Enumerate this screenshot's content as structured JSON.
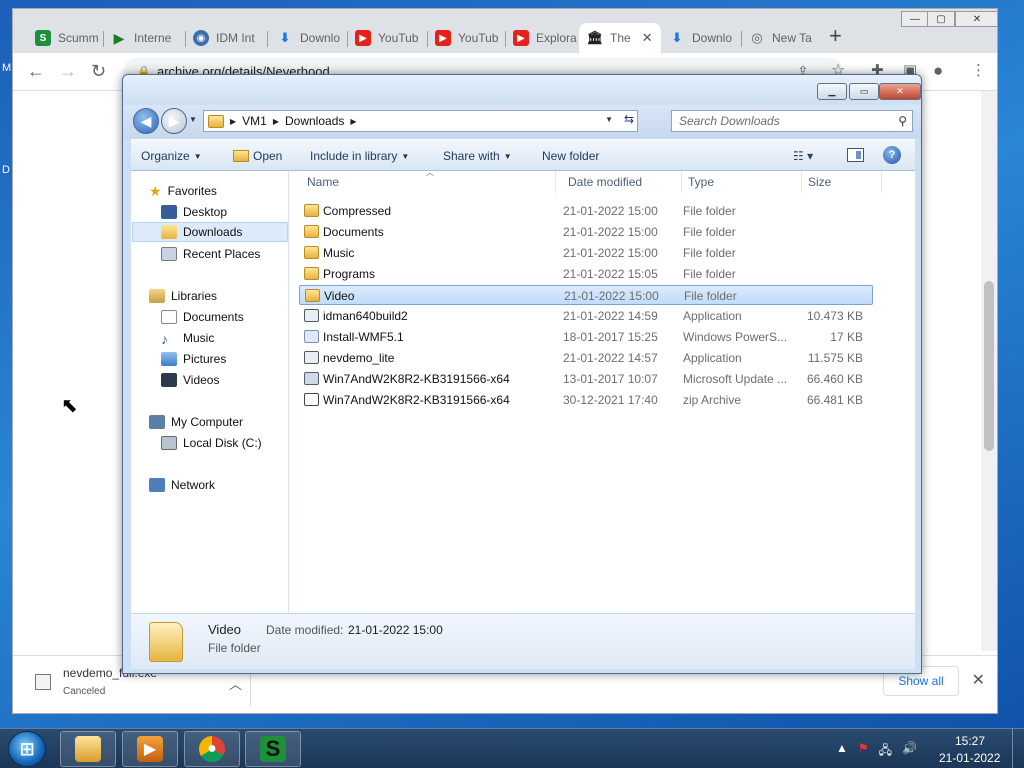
{
  "browser": {
    "tabs": [
      {
        "label": "Scumm",
        "icon": "scumm-icon",
        "color": "#1e8f3a"
      },
      {
        "label": "Interne",
        "icon": "play-icon",
        "color": "#1e7b1e"
      },
      {
        "label": "IDM Int",
        "icon": "globe-icon",
        "color": "#3a6fb0"
      },
      {
        "label": "Downlo",
        "icon": "download-icon",
        "color": "#1a73e8"
      },
      {
        "label": "YouTub",
        "icon": "youtube-icon",
        "color": "#e62117"
      },
      {
        "label": "YouTub",
        "icon": "youtube-icon",
        "color": "#e62117"
      },
      {
        "label": "Explora",
        "icon": "youtube-icon",
        "color": "#e62117"
      },
      {
        "label": "The",
        "icon": "archive-icon",
        "color": "#222222"
      },
      {
        "label": "Downlo",
        "icon": "download-icon",
        "color": "#1a73e8"
      },
      {
        "label": "New Ta",
        "icon": "chrome-icon",
        "color": "#5f6368"
      }
    ],
    "address": "archive.org/details/Neverhood",
    "download": {
      "filename": "nevdemo_full.exe",
      "status": "Canceled"
    },
    "show_all": "Show all"
  },
  "explorer": {
    "breadcrumb": [
      "VM1",
      "Downloads"
    ],
    "search_placeholder": "Search Downloads",
    "commands": {
      "organize": "Organize",
      "open": "Open",
      "include": "Include in library",
      "share": "Share with",
      "new_folder": "New folder"
    },
    "nav": {
      "favorites": "Favorites",
      "fav_items": [
        "Desktop",
        "Downloads",
        "Recent Places"
      ],
      "libraries": "Libraries",
      "lib_items": [
        "Documents",
        "Music",
        "Pictures",
        "Videos"
      ],
      "computer": "My Computer",
      "comp_items": [
        "Local Disk (C:)"
      ],
      "network": "Network",
      "selected": "Downloads"
    },
    "columns": [
      "Name",
      "Date modified",
      "Type",
      "Size"
    ],
    "files": [
      {
        "name": "Compressed",
        "date": "21-01-2022 15:00",
        "type": "File folder",
        "size": ""
      },
      {
        "name": "Documents",
        "date": "21-01-2022 15:00",
        "type": "File folder",
        "size": ""
      },
      {
        "name": "Music",
        "date": "21-01-2022 15:00",
        "type": "File folder",
        "size": ""
      },
      {
        "name": "Programs",
        "date": "21-01-2022 15:05",
        "type": "File folder",
        "size": ""
      },
      {
        "name": "Video",
        "date": "21-01-2022 15:00",
        "type": "File folder",
        "size": ""
      },
      {
        "name": "idman640build2",
        "date": "21-01-2022 14:59",
        "type": "Application",
        "size": "10.473 KB"
      },
      {
        "name": "Install-WMF5.1",
        "date": "18-01-2017 15:25",
        "type": "Windows PowerS...",
        "size": "17 KB"
      },
      {
        "name": "nevdemo_lite",
        "date": "21-01-2022 14:57",
        "type": "Application",
        "size": "11.575 KB"
      },
      {
        "name": "Win7AndW2K8R2-KB3191566-x64",
        "date": "13-01-2017 10:07",
        "type": "Microsoft Update ...",
        "size": "66.460 KB"
      },
      {
        "name": "Win7AndW2K8R2-KB3191566-x64",
        "date": "30-12-2021 17:40",
        "type": "zip Archive",
        "size": "66.481 KB"
      }
    ],
    "selected_file": "Video",
    "details": {
      "name": "Video",
      "type": "File folder",
      "date_label": "Date modified:",
      "date": "21-01-2022 15:00"
    }
  },
  "taskbar": {
    "time": "15:27",
    "date": "21-01-2022"
  }
}
